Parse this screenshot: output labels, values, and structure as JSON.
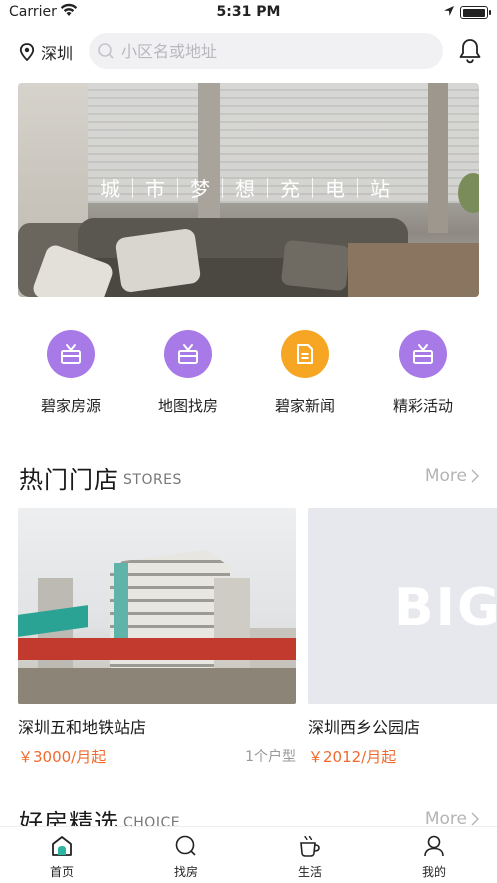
{
  "status_bar": {
    "carrier": "Carrier",
    "time": "5:31 PM",
    "battery_level": 1.0
  },
  "header": {
    "city": "深圳",
    "search_placeholder": "小区名或地址",
    "icons": [
      "location-pin-icon",
      "search-icon",
      "bell-icon"
    ]
  },
  "banner": {
    "chars": [
      "城",
      "市",
      "梦",
      "想",
      "充",
      "电",
      "站"
    ]
  },
  "quick_nav": {
    "items": [
      {
        "label": "碧家房源",
        "icon": "gift-box-icon",
        "color": "#a77ae8"
      },
      {
        "label": "地图找房",
        "icon": "gift-box-icon",
        "color": "#a77ae8"
      },
      {
        "label": "碧家新闻",
        "icon": "document-icon",
        "color": "#f6a623"
      },
      {
        "label": "精彩活动",
        "icon": "gift-box-icon",
        "color": "#a77ae8"
      }
    ]
  },
  "stores_section": {
    "title": "热门门店",
    "subtitle": "STORES",
    "more": "More"
  },
  "stores": [
    {
      "name": "深圳五和地铁站店",
      "price": "￥3000/月起",
      "units": "1个户型"
    },
    {
      "name": "深圳西乡公园店",
      "price": "￥2012/月起",
      "units": "",
      "logo_text": "BIG"
    }
  ],
  "choice_section": {
    "title": "好房精选",
    "subtitle": "CHOICE",
    "more": "More"
  },
  "tab_bar": {
    "tabs": [
      {
        "label": "首页",
        "icon": "home-icon",
        "active": true
      },
      {
        "label": "找房",
        "icon": "search-house-icon",
        "active": false
      },
      {
        "label": "生活",
        "icon": "coffee-cup-icon",
        "active": false
      },
      {
        "label": "我的",
        "icon": "user-icon",
        "active": false
      }
    ],
    "active_color": "#2bb5a3"
  },
  "colors": {
    "price": "#f06a2f",
    "accent_purple": "#a77ae8",
    "accent_orange": "#f6a623",
    "more_gray": "#b4b4b4"
  }
}
